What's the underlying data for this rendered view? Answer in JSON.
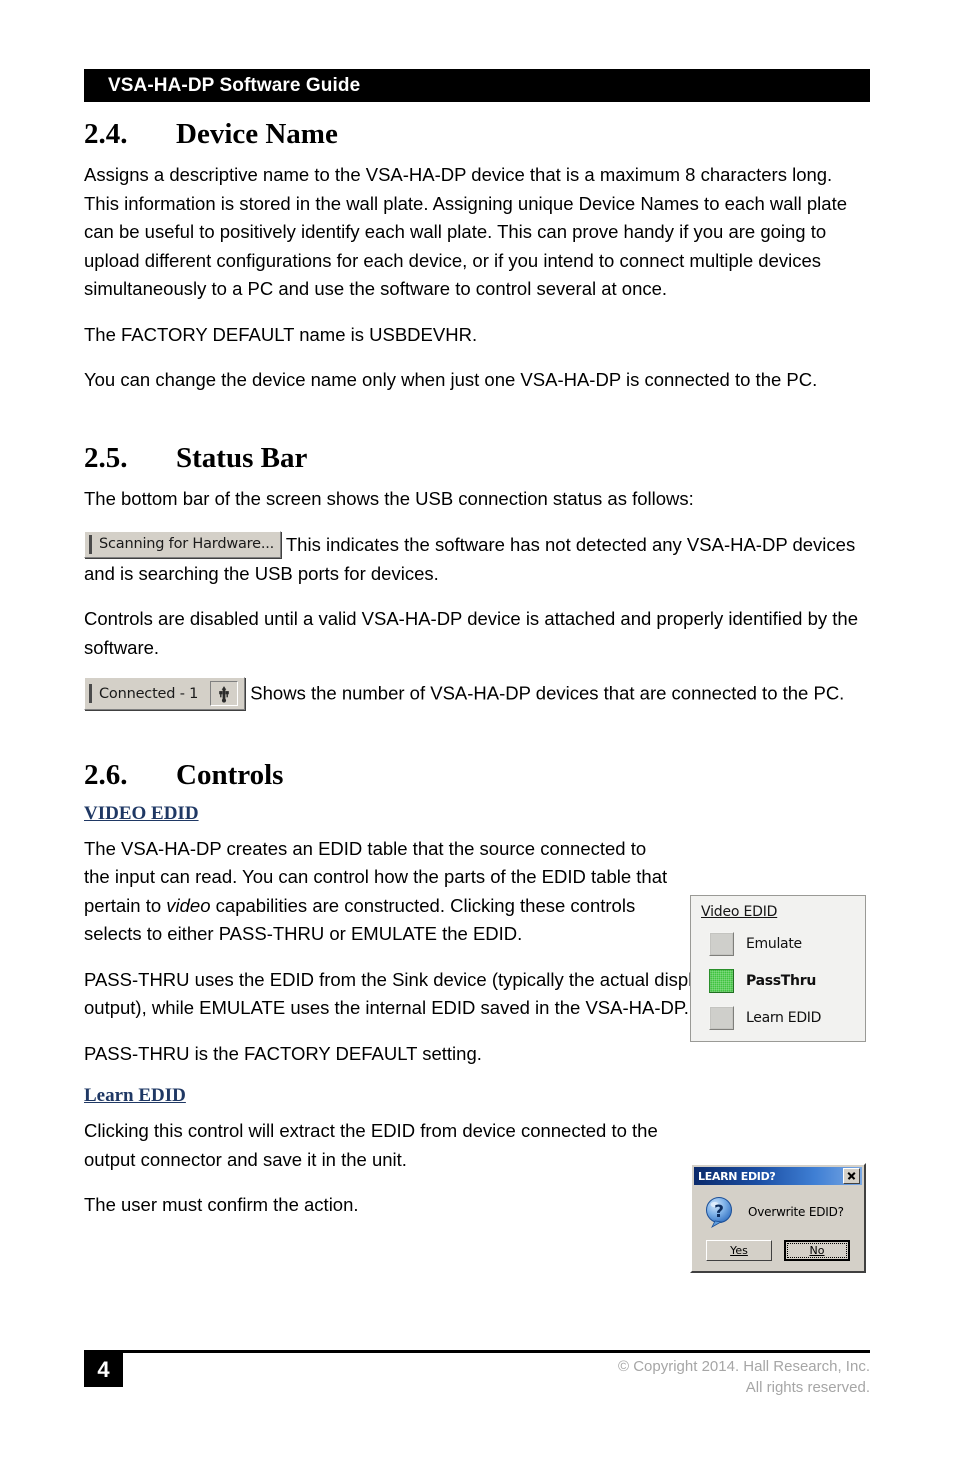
{
  "header": {
    "title": "VSA-HA-DP Software Guide"
  },
  "sections": {
    "device_name": {
      "number": "2.4.",
      "title": "Device Name",
      "paragraphs": [
        "Assigns a descriptive name to the VSA-HA-DP device that is a maximum 8 characters long. This information is stored in the wall plate. Assigning unique Device Names to each wall plate can be useful to positively identify each wall plate. This can prove handy if you are going to upload different configurations for each device, or if you intend to connect multiple devices simultaneously to a PC and use the software to control several at once.",
        "The FACTORY DEFAULT name is USBDEVHR.",
        "You can change the device name only when just one VSA-HA-DP is connected to the PC."
      ]
    },
    "status_bar": {
      "number": "2.5.",
      "title": "Status Bar",
      "intro": "The bottom bar of the screen shows the USB connection status as follows:",
      "scanning_widget": {
        "label": "Scanning for Hardware...",
        "caption": " This indicates the software has not detected any VSA-HA-DP devices and is searching the USB ports for devices."
      },
      "disabled_note": "Controls are disabled until a valid VSA-HA-DP device is attached and properly identified by the software.",
      "connected_widget": {
        "label": "Connected - 1",
        "icon": "usb-icon",
        "caption": " Shows the number of VSA-HA-DP devices that are connected to the PC."
      }
    },
    "controls": {
      "number": "2.6.",
      "title": "Controls",
      "video_edid": {
        "heading": "VIDEO EDID",
        "paragraph_pre": "The VSA-HA-DP creates an EDID table that the source connected to the input can read. You can control how the parts of the EDID table that pertain to ",
        "paragraph_italic": "video",
        "paragraph_post": " capabilities are constructed. Clicking these controls selects to either PASS-THRU or EMULATE the EDID.",
        "paragraph_2": "PASS-THRU uses the EDID from the Sink device (typically the actual display connected to the output), while EMULATE uses the internal EDID saved in the VSA-HA-DP.",
        "paragraph_3": "PASS-THRU is the FACTORY DEFAULT setting."
      },
      "learn_edid": {
        "heading": "Learn EDID",
        "paragraph_1": "Clicking this control will extract the EDID from device connected to the output connector and save it in the unit.",
        "paragraph_2": "The user must confirm the action."
      }
    }
  },
  "figures": {
    "video_edid_panel": {
      "title": "Video EDID",
      "options": [
        {
          "label": "Emulate",
          "state": "inactive"
        },
        {
          "label": "PassThru",
          "state": "active"
        },
        {
          "label": "Learn EDID",
          "state": "inactive"
        }
      ],
      "active_color": "#3fc43f"
    },
    "learn_edid_dialog": {
      "title": "LEARN EDID?",
      "close_icon": "close-icon",
      "icon": "question-icon",
      "message": "Overwrite EDID?",
      "buttons": [
        {
          "label": "Yes",
          "mnemonic": "Y",
          "default": false
        },
        {
          "label": "No",
          "mnemonic": "N",
          "default": true
        }
      ],
      "titlebar_color": "#1b4ea3"
    }
  },
  "footer": {
    "page_number": "4",
    "copyright_line_1": "© Copyright 2014. Hall Research, Inc.",
    "copyright_line_2": "All rights reserved."
  }
}
